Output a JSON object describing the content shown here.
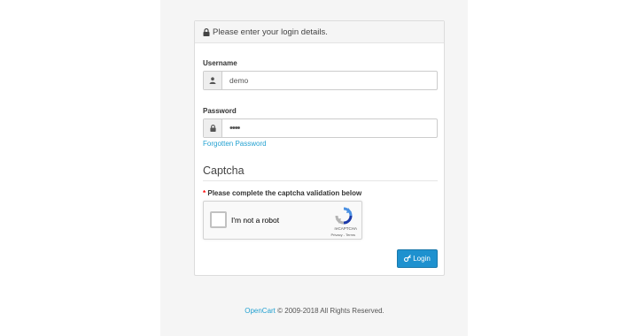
{
  "panel": {
    "heading": "Please enter your login details.",
    "heading_icon": "lock-icon"
  },
  "username": {
    "label": "Username",
    "value": "demo",
    "icon": "user-icon"
  },
  "password": {
    "label": "Password",
    "value": "••••",
    "icon": "lock-icon"
  },
  "forgotten_link": "Forgotten Password",
  "captcha": {
    "title": "Captcha",
    "required_star": "*",
    "required_text": "Please complete the captcha validation below",
    "checkbox_label": "I'm not a robot",
    "brand": "reCAPTCHA",
    "links": "Privacy - Terms",
    "checked": false
  },
  "login_button": {
    "label": "Login",
    "icon": "key-icon",
    "color": "#1e91cf"
  },
  "footer": {
    "link": "OpenCart",
    "text": "© 2009-2018 All Rights Reserved."
  },
  "colors": {
    "accent": "#1e91cf",
    "link": "#23a1d1",
    "required": "#ff0000"
  }
}
